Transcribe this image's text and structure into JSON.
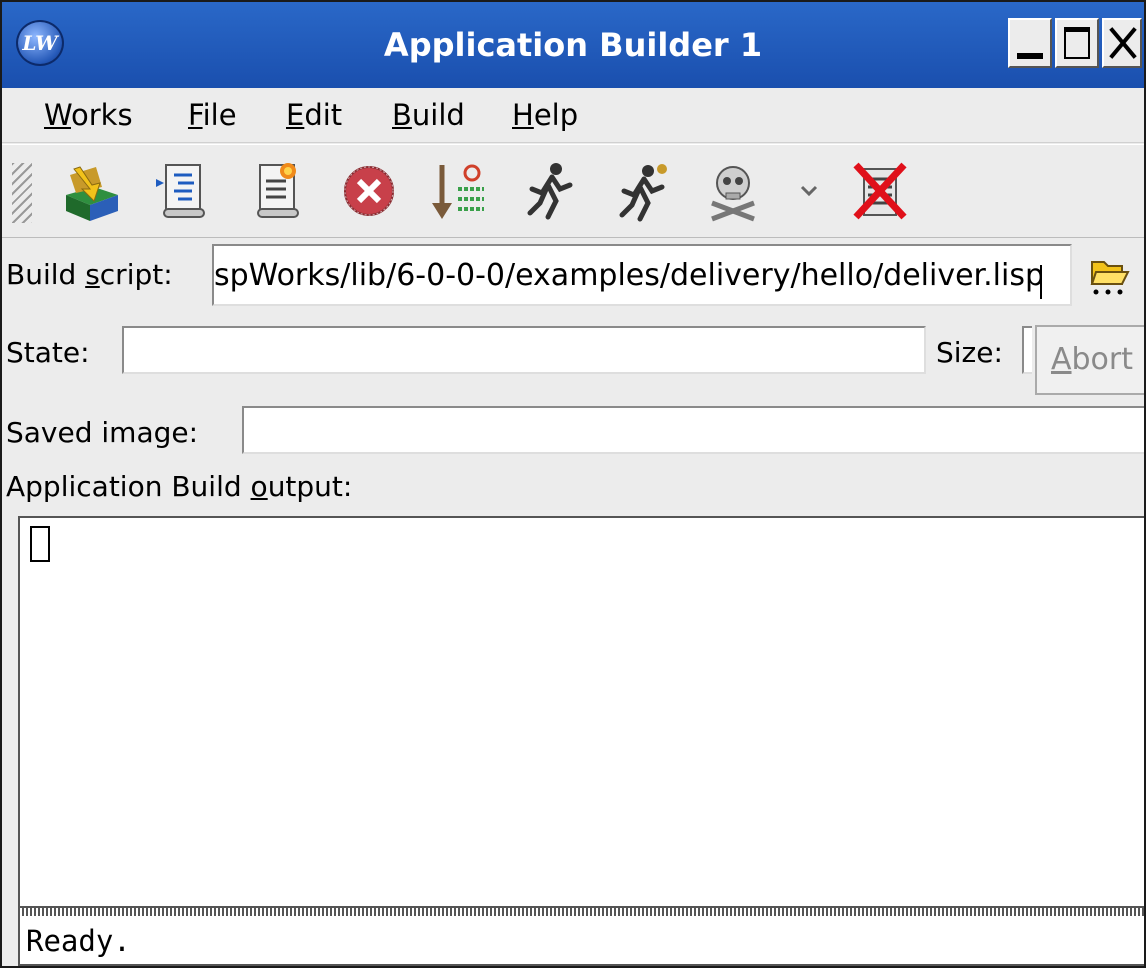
{
  "window": {
    "title": "Application Builder 1",
    "logo_text": "LW"
  },
  "menubar": {
    "items": [
      {
        "mnemonic": "W",
        "rest": "orks"
      },
      {
        "mnemonic": "F",
        "rest": "ile"
      },
      {
        "mnemonic": "E",
        "rest": "dit"
      },
      {
        "mnemonic": "B",
        "rest": "uild"
      },
      {
        "mnemonic": "H",
        "rest": "elp"
      }
    ]
  },
  "toolbar": {
    "icons": [
      "build-icon",
      "parse-script-icon",
      "edit-script-icon",
      "stop-icon",
      "load-icon",
      "run-icon",
      "run-test-icon",
      "kill-icon",
      "dropdown-arrow-icon",
      "clear-icon"
    ]
  },
  "form": {
    "build_script_label_pre": "Build ",
    "build_script_label_mn": "s",
    "build_script_label_post": "cript:",
    "build_script_value": "spWorks/lib/6-0-0-0/examples/delivery/hello/deliver.lisp",
    "state_label": "State:",
    "state_value": "",
    "size_label": "Size:",
    "size_value": "",
    "abort_mn": "A",
    "abort_rest": "bort",
    "saved_image_label": "Saved image:",
    "saved_image_value": "",
    "output_label_pre": "Application Build ",
    "output_label_mn": "o",
    "output_label_post": "utput:"
  },
  "status": {
    "text": "Ready."
  },
  "colors": {
    "titlebar": "#1a4fae",
    "background": "#ececec"
  }
}
